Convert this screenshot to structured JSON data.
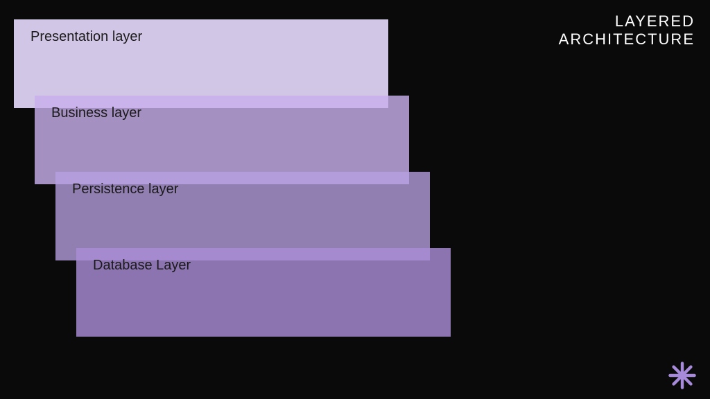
{
  "title": {
    "line1": "LAYERED",
    "line2": "ARCHITECTURE"
  },
  "layers": [
    {
      "label": "Presentation layer"
    },
    {
      "label": "Business layer"
    },
    {
      "label": "Persistence layer"
    },
    {
      "label": "Database Layer"
    }
  ],
  "colors": {
    "background": "#0a0a0a",
    "accent": "#a78bda"
  }
}
